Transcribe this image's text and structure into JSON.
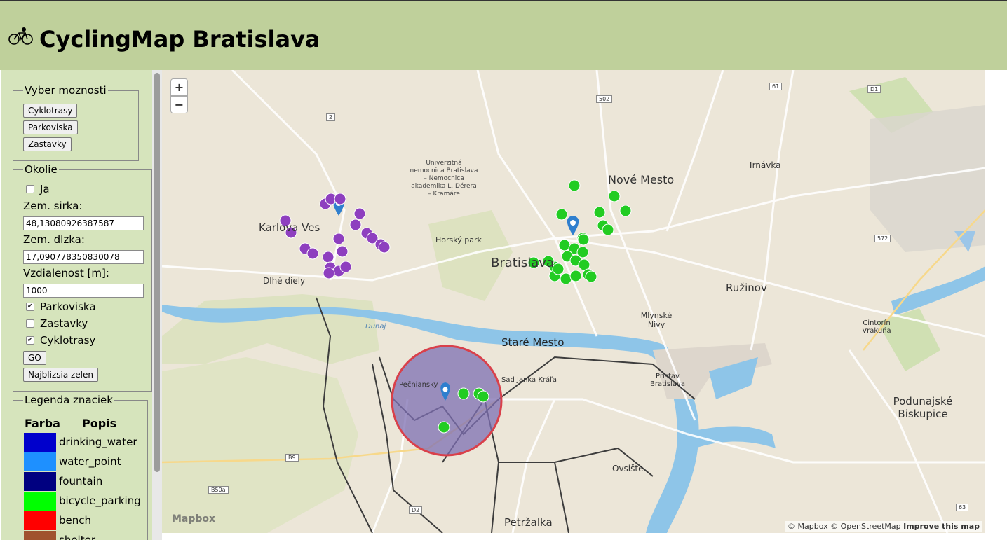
{
  "header": {
    "title": "CyclingMap Bratislava",
    "logo_icon": "bicycle-logo-icon"
  },
  "options": {
    "legend": "Vyber moznosti",
    "buttons": [
      "Cyklotrasy",
      "Parkoviska",
      "Zastavky"
    ]
  },
  "okolie": {
    "legend": "Okolie",
    "ja_label": "Ja",
    "ja_checked": false,
    "lat_label": "Zem. sirka:",
    "lat_value": "48,13080926387587",
    "lon_label": "Zem. dlzka:",
    "lon_value": "17,090778350830078",
    "dist_label": "Vzdialenost [m]:",
    "dist_value": "1000",
    "checks": [
      {
        "label": "Parkoviska",
        "checked": true
      },
      {
        "label": "Zastavky",
        "checked": false
      },
      {
        "label": "Cyklotrasy",
        "checked": true
      }
    ],
    "go_label": "GO",
    "nearest_label": "Najblizsia zelen"
  },
  "legend_box": {
    "legend": "Legenda znaciek",
    "col_color": "Farba",
    "col_desc": "Popis",
    "items": [
      {
        "color": "#0000cc",
        "label": "drinking_water"
      },
      {
        "color": "#1e90ff",
        "label": "water_point"
      },
      {
        "color": "#000080",
        "label": "fountain"
      },
      {
        "color": "#00ff00",
        "label": "bicycle_parking"
      },
      {
        "color": "#ff0000",
        "label": "bench"
      },
      {
        "color": "#a0522d",
        "label": "shelter"
      }
    ]
  },
  "map": {
    "zoom_in": "+",
    "zoom_out": "−",
    "mapbox_logo": "Mapbox",
    "attribution_prefix": "© Mapbox © OpenStreetMap",
    "attribution_link": "Improve this map",
    "place_labels": [
      "Nové Mesto",
      "Bratislava",
      "Ružinov",
      "Staré Mesto",
      "Karlova Ves",
      "Dlhé diely",
      "Petržalka",
      "Podunajské Biskupice",
      "Ovsište",
      "Trnávka",
      "Mlynské Nivy",
      "Horský park",
      "Pečniansky",
      "Sad Janka Kráľa",
      "Prístav Bratislava",
      "Cintorín Vrakuňa",
      "Univerzitná nemocnica Bratislava – Nemocnica akademika L. Dérera – Kramáre",
      "Dunaj"
    ],
    "road_shields": [
      "2",
      "502",
      "61",
      "D1",
      "572",
      "B9",
      "D2",
      "63",
      "B50a"
    ],
    "accent_colors": {
      "water": "#8ec5e8",
      "park": "#c8dba0",
      "circle": "#7d6fb3",
      "bike_marker": "#22cc22",
      "bus_marker": "#8e3fbf",
      "loc_marker": "#2f7fce"
    }
  }
}
